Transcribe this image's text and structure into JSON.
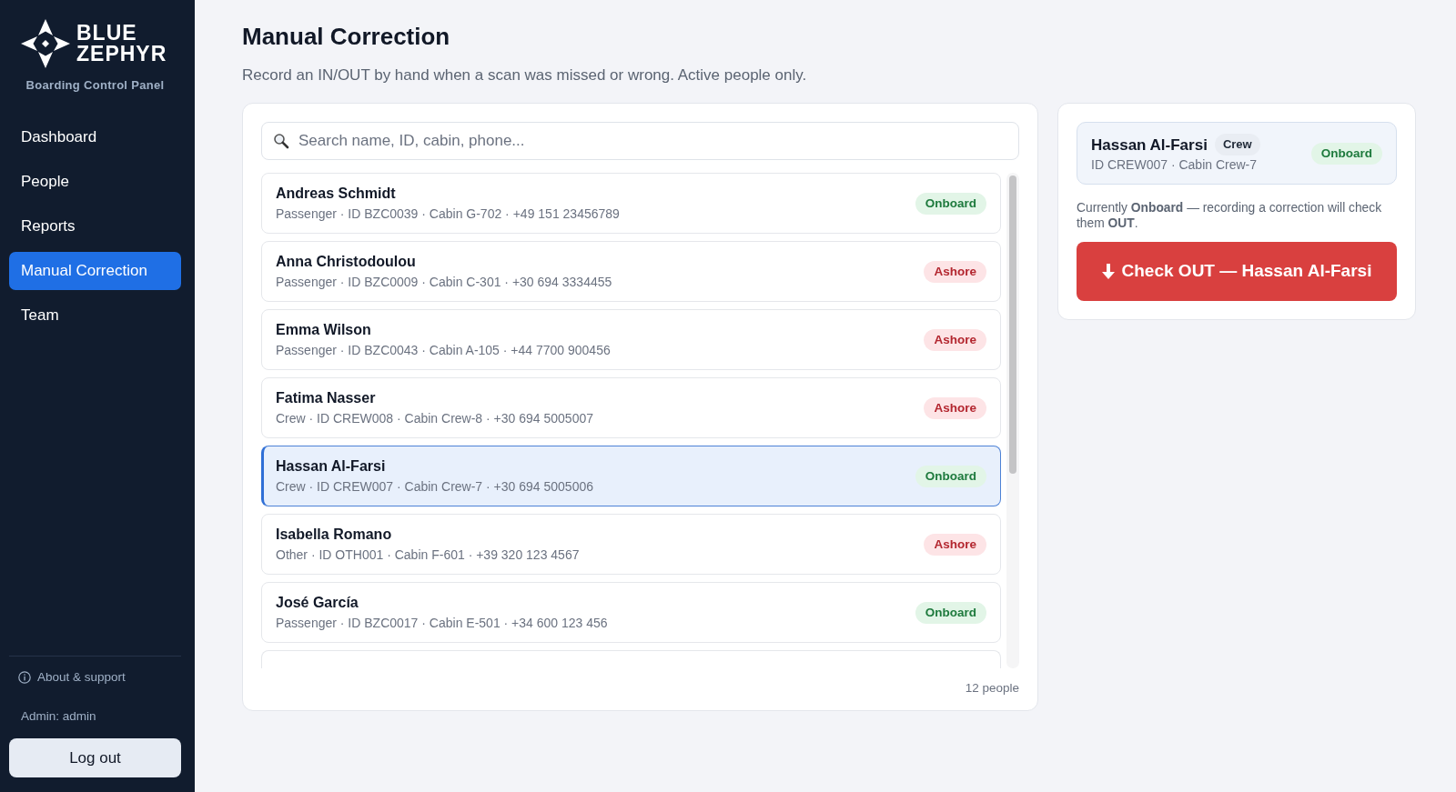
{
  "sidebar": {
    "brand": {
      "lines": [
        "BLUE",
        "ZEPHYR"
      ],
      "subtitle": "Boarding Control Panel"
    },
    "nav": [
      {
        "label": "Dashboard",
        "selected": false
      },
      {
        "label": "People",
        "selected": false
      },
      {
        "label": "Reports",
        "selected": false
      },
      {
        "label": "Manual Correction",
        "selected": true
      },
      {
        "label": "Team",
        "selected": false
      }
    ],
    "about": "About & support",
    "user": "Admin: admin",
    "logout": "Log out"
  },
  "page": {
    "title": "Manual Correction",
    "subtitle": "Record an IN/OUT by hand when a scan was missed or wrong. Active people only."
  },
  "search": {
    "placeholder": "Search name, ID, cabin, phone..."
  },
  "people": [
    {
      "name": "Andreas Schmidt",
      "meta": "Passenger · ID BZC0039 · Cabin G-702 · +49 151 23456789",
      "status": "Onboard",
      "onboard": true,
      "selected": false
    },
    {
      "name": "Anna Christodoulou",
      "meta": "Passenger · ID BZC0009 · Cabin C-301 · +30 694 3334455",
      "status": "Ashore",
      "onboard": false,
      "selected": false
    },
    {
      "name": "Emma Wilson",
      "meta": "Passenger · ID BZC0043 · Cabin A-105 · +44 7700 900456",
      "status": "Ashore",
      "onboard": false,
      "selected": false
    },
    {
      "name": "Fatima Nasser",
      "meta": "Crew · ID CREW008 · Cabin Crew-8 · +30 694 5005007",
      "status": "Ashore",
      "onboard": false,
      "selected": false
    },
    {
      "name": "Hassan Al-Farsi",
      "meta": "Crew · ID CREW007 · Cabin Crew-7 · +30 694 5005006",
      "status": "Onboard",
      "onboard": true,
      "selected": true
    },
    {
      "name": "Isabella Romano",
      "meta": "Other · ID OTH001 · Cabin F-601 · +39 320 123 4567",
      "status": "Ashore",
      "onboard": false,
      "selected": false
    },
    {
      "name": "José García",
      "meta": "Passenger · ID BZC0017 · Cabin E-501 · +34 600 123 456",
      "status": "Onboard",
      "onboard": true,
      "selected": false
    },
    {
      "selected": false
    }
  ],
  "count": "12 people",
  "detail": {
    "name": "Hassan Al-Farsi",
    "role": "Crew",
    "meta": "ID CREW007 · Cabin Crew-7",
    "status": "Onboard",
    "onboard": true,
    "note": "Currently **Onboard** — recording a correction will check them **OUT**.",
    "action": {
      "label": "Check OUT — Hassan Al-Farsi",
      "kind": "check_out"
    }
  }
}
